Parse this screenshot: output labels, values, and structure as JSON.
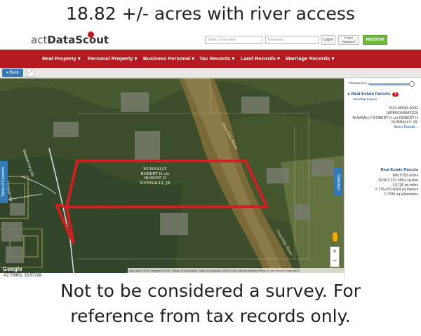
{
  "caption": {
    "top": "18.82 +/- acres with river access",
    "bottom_line1": "Not to be considered a survey.  For",
    "bottom_line2": "reference from tax records only."
  },
  "header": {
    "logo_prefix": "act",
    "logo_suffix": "DataScout",
    "email_placeholder": "Email / Username",
    "password_placeholder": "Password",
    "login_label": "Log in",
    "forgot_label": "Forgot Password?",
    "register_label": "REGISTER"
  },
  "nav": {
    "items": [
      {
        "label": "Real Property ▾"
      },
      {
        "label": "Personal Property ▾"
      },
      {
        "label": "Business Personal ▾"
      },
      {
        "label": "Tax Records ▾"
      },
      {
        "label": "Land Records ▾"
      },
      {
        "label": "Marriage Records ▾"
      }
    ]
  },
  "subnav": {
    "back_label": "◂ Back",
    "expand_icon": "⤢"
  },
  "map": {
    "toc_label": "Table of Contents",
    "selection_label": "Selection",
    "owner_label": "NUNNALLY ROBERT H c/o ROBERT H NUNNALLY, JR",
    "river_label": "Ouachita River",
    "river_label_2": "Ouachita River",
    "road_label": "Baseball Ferry Rd",
    "road_label_2": "Firetower Rd",
    "google_label": "Google",
    "attribution": "Map data ©2020 Imagery ©2020 , Maxar Technologies, State of Arkansas, USDA Farm Service Agency   Terms of Use   Report a map error",
    "coords": "-92.78953, 33.57108",
    "zoom_in": "+",
    "zoom_out": "−"
  },
  "panel": {
    "transparency_label": "Transparency",
    "transparency_value": 0.95,
    "layer_name": "Real Estate Parcels",
    "layer_count": "1",
    "onemap_label": "OneMap Layers",
    "parcel_id": "*013-00530-200R",
    "parcel_approx": "(APPROXIMATED)",
    "parcel_owner_1": "NUNNALLY ROBERT H c/o ROBERT H",
    "parcel_owner_2": "NUNNALLY, JR.",
    "more_details": "More Details...",
    "stats_title": "Real Estate Parcels",
    "acres": "686.5752 acres",
    "sqfeet": "29,907,231.4053 sq feet",
    "sqmiles": "1.0728 sq miles",
    "sqmeters": "2,778,475.4064 sq meters",
    "sqkm": "2.7785 sq kilometers"
  },
  "colors": {
    "nav": "#b3191e",
    "register": "#6cbb3c",
    "parcel_outline": "#d21f1f",
    "tab_blue": "#337ab7"
  }
}
